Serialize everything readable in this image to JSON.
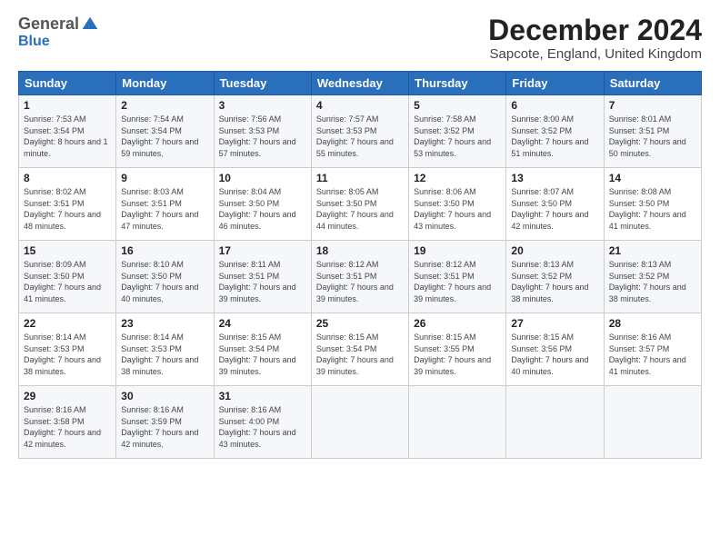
{
  "logo": {
    "general": "General",
    "blue": "Blue"
  },
  "header": {
    "title": "December 2024",
    "subtitle": "Sapcote, England, United Kingdom"
  },
  "weekdays": [
    "Sunday",
    "Monday",
    "Tuesday",
    "Wednesday",
    "Thursday",
    "Friday",
    "Saturday"
  ],
  "weeks": [
    [
      {
        "day": "1",
        "sunrise": "Sunrise: 7:53 AM",
        "sunset": "Sunset: 3:54 PM",
        "daylight": "Daylight: 8 hours and 1 minute."
      },
      {
        "day": "2",
        "sunrise": "Sunrise: 7:54 AM",
        "sunset": "Sunset: 3:54 PM",
        "daylight": "Daylight: 7 hours and 59 minutes."
      },
      {
        "day": "3",
        "sunrise": "Sunrise: 7:56 AM",
        "sunset": "Sunset: 3:53 PM",
        "daylight": "Daylight: 7 hours and 57 minutes."
      },
      {
        "day": "4",
        "sunrise": "Sunrise: 7:57 AM",
        "sunset": "Sunset: 3:53 PM",
        "daylight": "Daylight: 7 hours and 55 minutes."
      },
      {
        "day": "5",
        "sunrise": "Sunrise: 7:58 AM",
        "sunset": "Sunset: 3:52 PM",
        "daylight": "Daylight: 7 hours and 53 minutes."
      },
      {
        "day": "6",
        "sunrise": "Sunrise: 8:00 AM",
        "sunset": "Sunset: 3:52 PM",
        "daylight": "Daylight: 7 hours and 51 minutes."
      },
      {
        "day": "7",
        "sunrise": "Sunrise: 8:01 AM",
        "sunset": "Sunset: 3:51 PM",
        "daylight": "Daylight: 7 hours and 50 minutes."
      }
    ],
    [
      {
        "day": "8",
        "sunrise": "Sunrise: 8:02 AM",
        "sunset": "Sunset: 3:51 PM",
        "daylight": "Daylight: 7 hours and 48 minutes."
      },
      {
        "day": "9",
        "sunrise": "Sunrise: 8:03 AM",
        "sunset": "Sunset: 3:51 PM",
        "daylight": "Daylight: 7 hours and 47 minutes."
      },
      {
        "day": "10",
        "sunrise": "Sunrise: 8:04 AM",
        "sunset": "Sunset: 3:50 PM",
        "daylight": "Daylight: 7 hours and 46 minutes."
      },
      {
        "day": "11",
        "sunrise": "Sunrise: 8:05 AM",
        "sunset": "Sunset: 3:50 PM",
        "daylight": "Daylight: 7 hours and 44 minutes."
      },
      {
        "day": "12",
        "sunrise": "Sunrise: 8:06 AM",
        "sunset": "Sunset: 3:50 PM",
        "daylight": "Daylight: 7 hours and 43 minutes."
      },
      {
        "day": "13",
        "sunrise": "Sunrise: 8:07 AM",
        "sunset": "Sunset: 3:50 PM",
        "daylight": "Daylight: 7 hours and 42 minutes."
      },
      {
        "day": "14",
        "sunrise": "Sunrise: 8:08 AM",
        "sunset": "Sunset: 3:50 PM",
        "daylight": "Daylight: 7 hours and 41 minutes."
      }
    ],
    [
      {
        "day": "15",
        "sunrise": "Sunrise: 8:09 AM",
        "sunset": "Sunset: 3:50 PM",
        "daylight": "Daylight: 7 hours and 41 minutes."
      },
      {
        "day": "16",
        "sunrise": "Sunrise: 8:10 AM",
        "sunset": "Sunset: 3:50 PM",
        "daylight": "Daylight: 7 hours and 40 minutes."
      },
      {
        "day": "17",
        "sunrise": "Sunrise: 8:11 AM",
        "sunset": "Sunset: 3:51 PM",
        "daylight": "Daylight: 7 hours and 39 minutes."
      },
      {
        "day": "18",
        "sunrise": "Sunrise: 8:12 AM",
        "sunset": "Sunset: 3:51 PM",
        "daylight": "Daylight: 7 hours and 39 minutes."
      },
      {
        "day": "19",
        "sunrise": "Sunrise: 8:12 AM",
        "sunset": "Sunset: 3:51 PM",
        "daylight": "Daylight: 7 hours and 39 minutes."
      },
      {
        "day": "20",
        "sunrise": "Sunrise: 8:13 AM",
        "sunset": "Sunset: 3:52 PM",
        "daylight": "Daylight: 7 hours and 38 minutes."
      },
      {
        "day": "21",
        "sunrise": "Sunrise: 8:13 AM",
        "sunset": "Sunset: 3:52 PM",
        "daylight": "Daylight: 7 hours and 38 minutes."
      }
    ],
    [
      {
        "day": "22",
        "sunrise": "Sunrise: 8:14 AM",
        "sunset": "Sunset: 3:53 PM",
        "daylight": "Daylight: 7 hours and 38 minutes."
      },
      {
        "day": "23",
        "sunrise": "Sunrise: 8:14 AM",
        "sunset": "Sunset: 3:53 PM",
        "daylight": "Daylight: 7 hours and 38 minutes."
      },
      {
        "day": "24",
        "sunrise": "Sunrise: 8:15 AM",
        "sunset": "Sunset: 3:54 PM",
        "daylight": "Daylight: 7 hours and 39 minutes."
      },
      {
        "day": "25",
        "sunrise": "Sunrise: 8:15 AM",
        "sunset": "Sunset: 3:54 PM",
        "daylight": "Daylight: 7 hours and 39 minutes."
      },
      {
        "day": "26",
        "sunrise": "Sunrise: 8:15 AM",
        "sunset": "Sunset: 3:55 PM",
        "daylight": "Daylight: 7 hours and 39 minutes."
      },
      {
        "day": "27",
        "sunrise": "Sunrise: 8:15 AM",
        "sunset": "Sunset: 3:56 PM",
        "daylight": "Daylight: 7 hours and 40 minutes."
      },
      {
        "day": "28",
        "sunrise": "Sunrise: 8:16 AM",
        "sunset": "Sunset: 3:57 PM",
        "daylight": "Daylight: 7 hours and 41 minutes."
      }
    ],
    [
      {
        "day": "29",
        "sunrise": "Sunrise: 8:16 AM",
        "sunset": "Sunset: 3:58 PM",
        "daylight": "Daylight: 7 hours and 42 minutes."
      },
      {
        "day": "30",
        "sunrise": "Sunrise: 8:16 AM",
        "sunset": "Sunset: 3:59 PM",
        "daylight": "Daylight: 7 hours and 42 minutes."
      },
      {
        "day": "31",
        "sunrise": "Sunrise: 8:16 AM",
        "sunset": "Sunset: 4:00 PM",
        "daylight": "Daylight: 7 hours and 43 minutes."
      },
      null,
      null,
      null,
      null
    ]
  ]
}
